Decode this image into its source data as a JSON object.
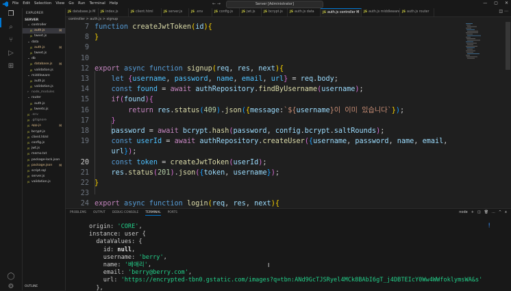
{
  "window": {
    "title": "Server [Administrator]",
    "menu": [
      "File",
      "Edit",
      "Selection",
      "View",
      "Go",
      "Run",
      "Terminal",
      "Help"
    ]
  },
  "explorer": {
    "title": "EXPLORER",
    "root": "SERVER",
    "outline": "OUTLINE",
    "tree": [
      {
        "label": "controller",
        "indent": 1,
        "folder": true,
        "open": true,
        "color": "#cccccc",
        "badge": ""
      },
      {
        "label": "auth.js",
        "indent": 2,
        "folder": false,
        "color": "#e2c08d",
        "badge": "M",
        "selected": true
      },
      {
        "label": "tweet.js",
        "indent": 2,
        "folder": false,
        "color": "#cccccc",
        "badge": ""
      },
      {
        "label": "data",
        "indent": 1,
        "folder": true,
        "open": true,
        "color": "#cccccc",
        "badge": ""
      },
      {
        "label": "auth.js",
        "indent": 2,
        "folder": false,
        "color": "#e2c08d",
        "badge": "M"
      },
      {
        "label": "tweet.js",
        "indent": 2,
        "folder": false,
        "color": "#cccccc",
        "badge": ""
      },
      {
        "label": "db",
        "indent": 1,
        "folder": true,
        "open": true,
        "color": "#cccccc",
        "badge": ""
      },
      {
        "label": "database.js",
        "indent": 2,
        "folder": false,
        "color": "#e2c08d",
        "badge": "M"
      },
      {
        "label": "validation.js",
        "indent": 2,
        "folder": false,
        "color": "#cccccc",
        "badge": ""
      },
      {
        "label": "middleware",
        "indent": 1,
        "folder": true,
        "open": true,
        "color": "#cccccc",
        "badge": ""
      },
      {
        "label": "auth.js",
        "indent": 2,
        "folder": false,
        "color": "#cccccc",
        "badge": ""
      },
      {
        "label": "validation.js",
        "indent": 2,
        "folder": false,
        "color": "#cccccc",
        "badge": ""
      },
      {
        "label": "node_modules",
        "indent": 1,
        "folder": true,
        "open": false,
        "color": "#8c8c8c",
        "badge": ""
      },
      {
        "label": "router",
        "indent": 1,
        "folder": true,
        "open": true,
        "color": "#cccccc",
        "badge": ""
      },
      {
        "label": "auth.js",
        "indent": 2,
        "folder": false,
        "color": "#cccccc",
        "badge": ""
      },
      {
        "label": "tweets.js",
        "indent": 2,
        "folder": false,
        "color": "#cccccc",
        "badge": ""
      },
      {
        "label": ".env",
        "indent": 1,
        "folder": false,
        "color": "#8c8c8c",
        "badge": ""
      },
      {
        "label": ".gitignore",
        "indent": 1,
        "folder": false,
        "color": "#8c8c8c",
        "badge": ""
      },
      {
        "label": "app.js",
        "indent": 1,
        "folder": false,
        "color": "#e2c08d",
        "badge": "M"
      },
      {
        "label": "bcrypt.js",
        "indent": 1,
        "folder": false,
        "color": "#cccccc",
        "badge": ""
      },
      {
        "label": "client.html",
        "indent": 1,
        "folder": false,
        "color": "#cccccc",
        "badge": ""
      },
      {
        "label": "config.js",
        "indent": 1,
        "folder": false,
        "color": "#cccccc",
        "badge": ""
      },
      {
        "label": "jwt.js",
        "indent": 1,
        "folder": false,
        "color": "#cccccc",
        "badge": ""
      },
      {
        "label": "memo.txt",
        "indent": 1,
        "folder": false,
        "color": "#cccccc",
        "badge": ""
      },
      {
        "label": "package-lock.json",
        "indent": 1,
        "folder": false,
        "color": "#cccccc",
        "badge": ""
      },
      {
        "label": "package.json",
        "indent": 1,
        "folder": false,
        "color": "#e2c08d",
        "badge": "M"
      },
      {
        "label": "script.sql",
        "indent": 1,
        "folder": false,
        "color": "#cccccc",
        "badge": ""
      },
      {
        "label": "server.js",
        "indent": 1,
        "folder": false,
        "color": "#cccccc",
        "badge": ""
      },
      {
        "label": "validation.js",
        "indent": 1,
        "folder": false,
        "color": "#cccccc",
        "badge": ""
      }
    ]
  },
  "tabs": [
    {
      "label": "database.js M",
      "active": false
    },
    {
      "label": "index.js",
      "active": false
    },
    {
      "label": "client.html",
      "active": false
    },
    {
      "label": "server.js",
      "active": false
    },
    {
      "label": ".env",
      "active": false
    },
    {
      "label": "config.js",
      "active": false
    },
    {
      "label": "jwt.js",
      "active": false
    },
    {
      "label": "bcrypt.js",
      "active": false
    },
    {
      "label": "auth.js data",
      "active": false
    },
    {
      "label": "auth.js controller M",
      "active": true
    },
    {
      "label": "auth.js middleware",
      "active": false
    },
    {
      "label": "auth.js router",
      "active": false
    }
  ],
  "breadcrumb": "controller > auth.js > signup",
  "editor": {
    "current_line": "20",
    "lines": [
      {
        "n": "7",
        "tokens": [
          [
            "kw",
            "function "
          ],
          [
            "fn",
            "createJwtToken"
          ],
          [
            "br1",
            "("
          ],
          [
            "vr",
            "id"
          ],
          [
            "br1",
            ")"
          ],
          [
            "br1",
            "{"
          ]
        ]
      },
      {
        "n": "8",
        "tokens": [
          [
            "br1",
            "}"
          ]
        ]
      },
      {
        "n": "9",
        "tokens": []
      },
      {
        "n": "10",
        "tokens": []
      },
      {
        "n": "12",
        "tokens": [
          [
            "kw2",
            "export "
          ],
          [
            "kw",
            "async function "
          ],
          [
            "fn",
            "signup"
          ],
          [
            "br1",
            "("
          ],
          [
            "vr",
            "req"
          ],
          [
            "pl",
            ", "
          ],
          [
            "vr",
            "res"
          ],
          [
            "pl",
            ", "
          ],
          [
            "vr",
            "next"
          ],
          [
            "br1",
            ")"
          ],
          [
            "br1",
            "{"
          ]
        ]
      },
      {
        "n": "13",
        "tokens": [
          [
            "pl",
            "    "
          ],
          [
            "kw",
            "let "
          ],
          [
            "br2",
            "{"
          ],
          [
            "cn",
            "username"
          ],
          [
            "pl",
            ", "
          ],
          [
            "cn",
            "password"
          ],
          [
            "pl",
            ", "
          ],
          [
            "cn",
            "name"
          ],
          [
            "pl",
            ", "
          ],
          [
            "cn",
            "email"
          ],
          [
            "pl",
            ", "
          ],
          [
            "cn",
            "url"
          ],
          [
            "br2",
            "}"
          ],
          [
            "pl",
            " = "
          ],
          [
            "vr",
            "req"
          ],
          [
            "pl",
            "."
          ],
          [
            "vr",
            "body"
          ],
          [
            "pl",
            ";"
          ]
        ]
      },
      {
        "n": "14",
        "tokens": [
          [
            "pl",
            "    "
          ],
          [
            "kw",
            "const "
          ],
          [
            "cn",
            "found"
          ],
          [
            "pl",
            " = "
          ],
          [
            "kw2",
            "await "
          ],
          [
            "vr",
            "authRepository"
          ],
          [
            "pl",
            "."
          ],
          [
            "fn",
            "findByUsername"
          ],
          [
            "br2",
            "("
          ],
          [
            "vr",
            "username"
          ],
          [
            "br2",
            ")"
          ],
          [
            "pl",
            ";"
          ]
        ]
      },
      {
        "n": "15",
        "tokens": [
          [
            "pl",
            "    "
          ],
          [
            "kw2",
            "if"
          ],
          [
            "br2",
            "("
          ],
          [
            "vr",
            "found"
          ],
          [
            "br2",
            ")"
          ],
          [
            "br2",
            "{"
          ]
        ]
      },
      {
        "n": "16",
        "tokens": [
          [
            "pl",
            "        "
          ],
          [
            "kw2",
            "return "
          ],
          [
            "vr",
            "res"
          ],
          [
            "pl",
            "."
          ],
          [
            "fn",
            "status"
          ],
          [
            "br3",
            "("
          ],
          [
            "num",
            "409"
          ],
          [
            "br3",
            ")"
          ],
          [
            "pl",
            "."
          ],
          [
            "fn",
            "json"
          ],
          [
            "br3",
            "("
          ],
          [
            "br1",
            "{"
          ],
          [
            "vr",
            "message"
          ],
          [
            "pl",
            ":"
          ],
          [
            "str",
            "`${"
          ],
          [
            "vr",
            "username"
          ],
          [
            "str",
            "}이 이미 있습니다`"
          ],
          [
            "br1",
            "}"
          ],
          [
            "br3",
            ")"
          ],
          [
            "pl",
            ";"
          ]
        ]
      },
      {
        "n": "17",
        "tokens": [
          [
            "pl",
            "    "
          ],
          [
            "br2",
            "}"
          ]
        ]
      },
      {
        "n": "18",
        "tokens": [
          [
            "pl",
            "    "
          ],
          [
            "vr",
            "password"
          ],
          [
            "pl",
            " = "
          ],
          [
            "kw2",
            "await "
          ],
          [
            "vr",
            "bcrypt"
          ],
          [
            "pl",
            "."
          ],
          [
            "fn",
            "hash"
          ],
          [
            "br2",
            "("
          ],
          [
            "vr",
            "password"
          ],
          [
            "pl",
            ", "
          ],
          [
            "vr",
            "config"
          ],
          [
            "pl",
            "."
          ],
          [
            "vr",
            "bcrypt"
          ],
          [
            "pl",
            "."
          ],
          [
            "vr",
            "saltRounds"
          ],
          [
            "br2",
            ")"
          ],
          [
            "pl",
            ";"
          ]
        ]
      },
      {
        "n": "19",
        "tokens": [
          [
            "pl",
            "    "
          ],
          [
            "kw",
            "const "
          ],
          [
            "cn",
            "userId"
          ],
          [
            "pl",
            " = "
          ],
          [
            "kw2",
            "await "
          ],
          [
            "vr",
            "authRepository"
          ],
          [
            "pl",
            "."
          ],
          [
            "fn",
            "createUser"
          ],
          [
            "br2",
            "("
          ],
          [
            "br3",
            "{"
          ],
          [
            "vr",
            "username"
          ],
          [
            "pl",
            ", "
          ],
          [
            "vr",
            "password"
          ],
          [
            "pl",
            ", "
          ],
          [
            "vr",
            "name"
          ],
          [
            "pl",
            ", "
          ],
          [
            "vr",
            "email"
          ],
          [
            "pl",
            ","
          ]
        ]
      },
      {
        "n": "",
        "tokens": [
          [
            "pl",
            "    "
          ],
          [
            "vr",
            "url"
          ],
          [
            "br3",
            "}"
          ],
          [
            "br2",
            ")"
          ],
          [
            "pl",
            ";"
          ]
        ]
      },
      {
        "n": "20",
        "tokens": [
          [
            "pl",
            "    "
          ],
          [
            "kw",
            "const "
          ],
          [
            "cn",
            "token"
          ],
          [
            "pl",
            " = "
          ],
          [
            "fn",
            "createJwtToken"
          ],
          [
            "br2",
            "("
          ],
          [
            "vr",
            "userId"
          ],
          [
            "br2",
            ")"
          ],
          [
            "pl",
            ";"
          ]
        ]
      },
      {
        "n": "21",
        "tokens": [
          [
            "pl",
            "    "
          ],
          [
            "vr",
            "res"
          ],
          [
            "pl",
            "."
          ],
          [
            "fn",
            "status"
          ],
          [
            "br2",
            "("
          ],
          [
            "num",
            "201"
          ],
          [
            "br2",
            ")"
          ],
          [
            "pl",
            "."
          ],
          [
            "fn",
            "json"
          ],
          [
            "br2",
            "("
          ],
          [
            "br3",
            "{"
          ],
          [
            "vr",
            "token"
          ],
          [
            "pl",
            ", "
          ],
          [
            "vr",
            "username"
          ],
          [
            "br3",
            "}"
          ],
          [
            "br2",
            ")"
          ],
          [
            "pl",
            ";"
          ]
        ]
      },
      {
        "n": "22",
        "tokens": [
          [
            "br1",
            "}"
          ]
        ]
      },
      {
        "n": "23",
        "tokens": []
      },
      {
        "n": "24",
        "tokens": [
          [
            "kw2",
            "export "
          ],
          [
            "kw",
            "async function "
          ],
          [
            "fn",
            "login"
          ],
          [
            "br1",
            "("
          ],
          [
            "vr",
            "req"
          ],
          [
            "pl",
            ", "
          ],
          [
            "vr",
            "res"
          ],
          [
            "pl",
            ", "
          ],
          [
            "vr",
            "next"
          ],
          [
            "br1",
            ")"
          ],
          [
            "br1",
            "{"
          ]
        ]
      }
    ]
  },
  "panel": {
    "tabs": [
      "PROBLEMS",
      "OUTPUT",
      "DEBUG CONSOLE",
      "TERMINAL",
      "PORTS"
    ],
    "active_tab": "TERMINAL",
    "actions": [
      "node",
      "+",
      "split",
      "trash",
      "...",
      "^",
      "x"
    ],
    "terminal_lines": [
      [
        [
          "p",
          "origin: "
        ],
        [
          "s",
          "'CORE'"
        ],
        [
          "p",
          ","
        ]
      ],
      [
        [
          "p",
          "instance: user {"
        ]
      ],
      [
        [
          "p",
          "  dataValues: {"
        ]
      ],
      [
        [
          "p",
          "    id: "
        ],
        [
          "n",
          "null"
        ],
        [
          "p",
          ","
        ]
      ],
      [
        [
          "p",
          "    username: "
        ],
        [
          "s",
          "'berry'"
        ],
        [
          "p",
          ","
        ]
      ],
      [
        [
          "p",
          "    name: "
        ],
        [
          "s",
          "'베애리'"
        ],
        [
          "p",
          ","
        ]
      ],
      [
        [
          "p",
          "    email: "
        ],
        [
          "s",
          "'berry@berry.com'"
        ],
        [
          "p",
          ","
        ]
      ],
      [
        [
          "p",
          "    url: "
        ],
        [
          "s",
          "'https://encrypted-tbn0.gstatic.com/images?q=tbn:ANd9GcTJSRyel4MCk8BAbI6gT_j4DBTEIcY0Ww4WWfoklymsWA&s'"
        ]
      ],
      [
        [
          "p",
          "  },"
        ]
      ],
      [
        [
          "p",
          "  _previousDataValues: {"
        ]
      ]
    ]
  }
}
